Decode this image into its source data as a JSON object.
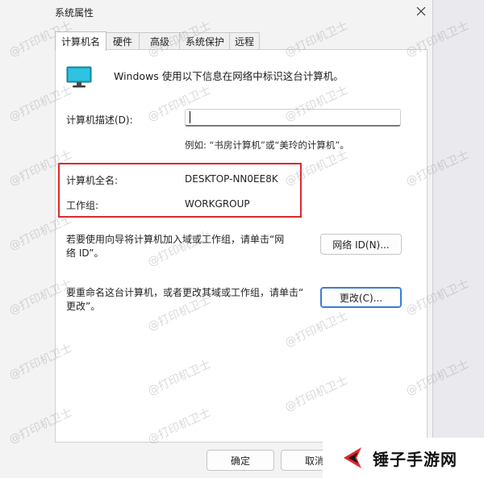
{
  "window": {
    "title": "系统属性"
  },
  "tabs": [
    {
      "label": "计算机名",
      "active": true
    },
    {
      "label": "硬件",
      "active": false
    },
    {
      "label": "高级",
      "active": false
    },
    {
      "label": "系统保护",
      "active": false
    },
    {
      "label": "远程",
      "active": false
    }
  ],
  "intro_text": "Windows 使用以下信息在网络中标识这台计算机。",
  "description": {
    "label": "计算机描述(D):",
    "value": "",
    "example": "例如: “书房计算机”或“美玲的计算机”。"
  },
  "full_name": {
    "label": "计算机全名:",
    "value": "DESKTOP-NN0EE8K"
  },
  "workgroup": {
    "label": "工作组:",
    "value": "WORKGROUP"
  },
  "network_id": {
    "text_line1": "若要使用向导将计算机加入域或工作组，请单击“网",
    "text_line2": "络 ID”。",
    "button": "网络 ID(N)..."
  },
  "rename": {
    "text_line1": "要重命名这台计算机，或者更改其域或工作组，请单击“",
    "text_line2": "更改”。",
    "button": "更改(C)..."
  },
  "footer": {
    "ok": "确定",
    "cancel": "取消"
  },
  "watermark_text": "@打印机卫士",
  "brand": {
    "name": "锤子手游网",
    "accent": "#e0262e"
  },
  "colors": {
    "highlight": "#e0262e",
    "primary_border": "#3a7bd5",
    "monitor": "#1aa7c9"
  },
  "icons": {
    "close": "close-icon",
    "monitor": "computer-monitor-icon",
    "brand": "brand-logo-icon"
  }
}
